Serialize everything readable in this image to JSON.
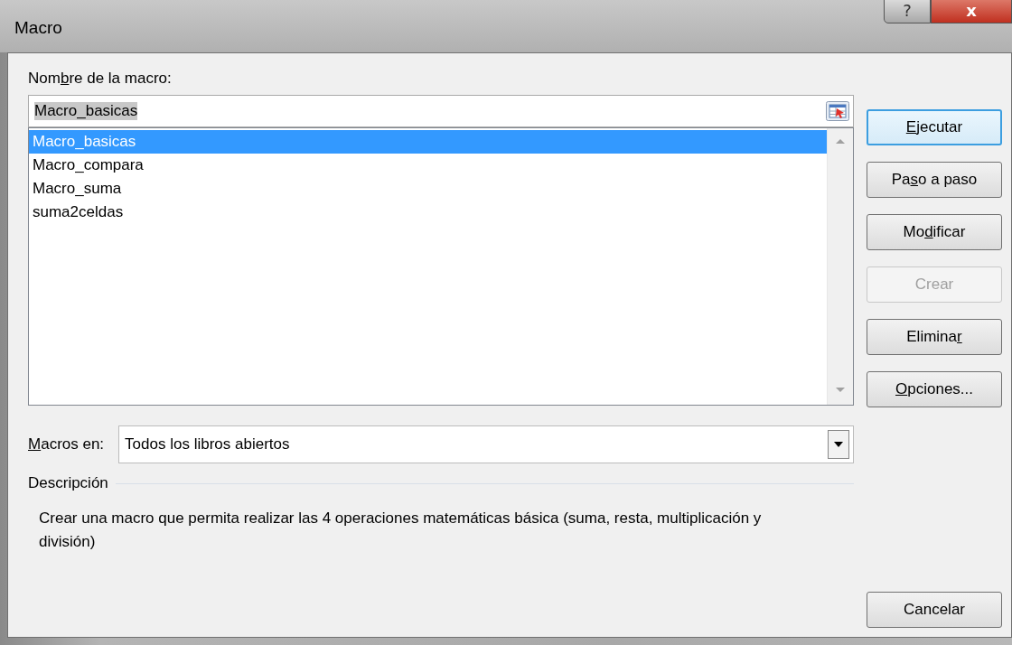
{
  "window": {
    "title": "Macro",
    "help_button": "?",
    "close_button": "x"
  },
  "macro_name": {
    "label": {
      "before": "Nom",
      "key": "b",
      "after": "re de la macro:"
    },
    "value": "Macro_basicas"
  },
  "macros": [
    {
      "name": "Macro_basicas",
      "selected": true
    },
    {
      "name": "Macro_compara",
      "selected": false
    },
    {
      "name": "Macro_suma",
      "selected": false
    },
    {
      "name": "suma2celdas",
      "selected": false
    }
  ],
  "buttons": [
    {
      "label": {
        "key": "E",
        "after": "jecutar"
      },
      "default": true,
      "disabled": false
    },
    {
      "label": {
        "before": "Pa",
        "key": "s",
        "after": "o a paso"
      },
      "default": false,
      "disabled": false
    },
    {
      "label": {
        "before": "Mo",
        "key": "d",
        "after": "ificar"
      },
      "default": false,
      "disabled": false
    },
    {
      "label": {
        "before": "Crear"
      },
      "default": false,
      "disabled": true
    },
    {
      "label": {
        "before": "Elimina",
        "key": "r"
      },
      "default": false,
      "disabled": false
    },
    {
      "label": {
        "key": "O",
        "after": "pciones..."
      },
      "default": false,
      "disabled": false
    }
  ],
  "macros_in": {
    "label": {
      "key": "M",
      "after": "acros en:"
    },
    "value": "Todos los libros abiertos"
  },
  "description": {
    "label": "Descripción",
    "text": "Crear una macro que permita realizar las 4 operaciones matemáticas básica (suma, resta, multiplicación y división)"
  },
  "cancel_button": "Cancelar"
}
